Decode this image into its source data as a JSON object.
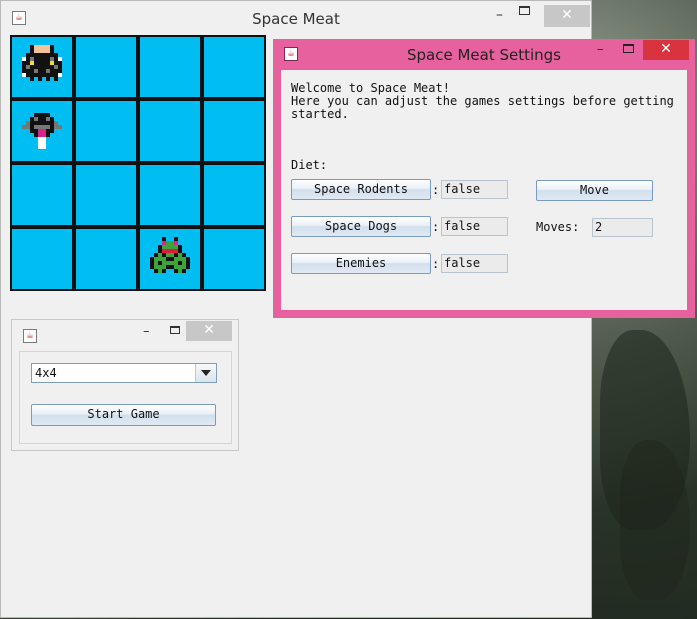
{
  "main_window": {
    "title": "Space Meat"
  },
  "grid": {
    "size": 4,
    "sprites": [
      {
        "name": "astronaut-sprite",
        "row": 0,
        "col": 0
      },
      {
        "name": "robot-sprite",
        "row": 1,
        "col": 0
      },
      {
        "name": "green-alien-sprite",
        "row": 3,
        "col": 2
      }
    ]
  },
  "launcher": {
    "board_size_selected": "4x4",
    "start_label": "Start Game"
  },
  "settings": {
    "title": "Space Meat Settings",
    "welcome_lines": [
      "Welcome to Space Meat!",
      "Here you can adjust the games settings before getting",
      "started."
    ],
    "diet_label": "Diet:",
    "diet_items": [
      {
        "label": "Space Rodents",
        "value": "false"
      },
      {
        "label": "Space Dogs",
        "value": "false"
      },
      {
        "label": "Enemies",
        "value": "false"
      }
    ],
    "separator": ":",
    "move_label": "Move",
    "moves_label": "Moves:",
    "moves_value": "2"
  },
  "colors": {
    "cell": "#00bdf2",
    "settings_frame": "#e8619f",
    "close_active": "#d9333f"
  }
}
